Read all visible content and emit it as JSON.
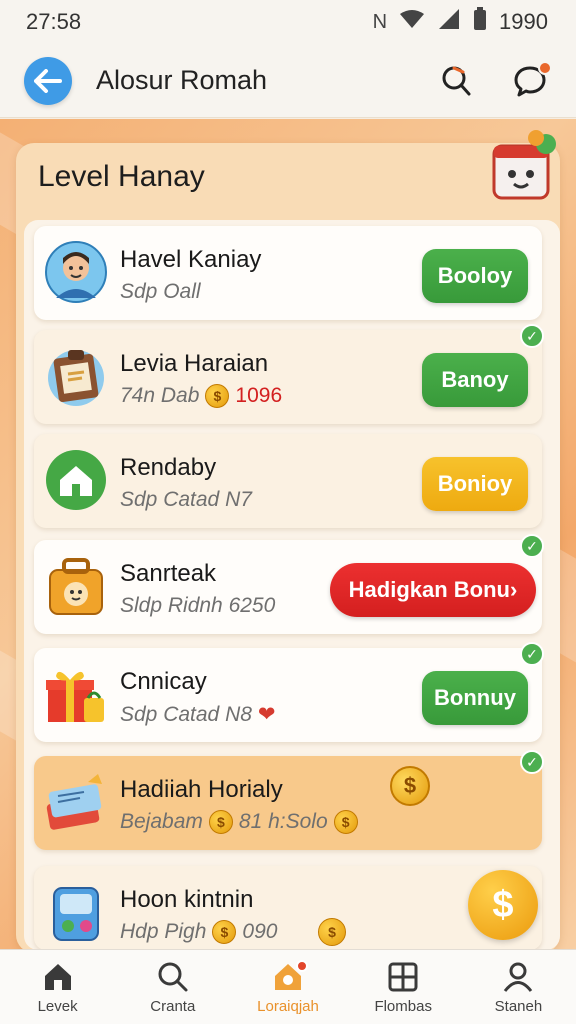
{
  "status_bar": {
    "time": "27:58",
    "battery": "1990"
  },
  "header": {
    "title": "Alosur Romah"
  },
  "panel": {
    "title": "Level Hanay"
  },
  "items": [
    {
      "title": "Havel Kaniay",
      "subtitle": "Sdp Oall",
      "button": "Booloy",
      "button_color": "#43a843",
      "checked": false,
      "icon": "avatar-icon"
    },
    {
      "title": "Levia Haraian",
      "subtitle": "74n Dab",
      "reward": "1096",
      "button": "Banoy",
      "button_color": "#43a843",
      "checked": true,
      "icon": "notebook-icon"
    },
    {
      "title": "Rendaby",
      "subtitle": "Sdp Catad N7",
      "button": "Bonioy",
      "button_color": "#f2b51c",
      "checked": false,
      "icon": "home-icon"
    },
    {
      "title": "Sanrteak",
      "subtitle": "Sldp Ridnh 6250",
      "button": "Hadigkan Bonu›",
      "button_color": "#e02828",
      "checked": true,
      "icon": "bag-icon"
    },
    {
      "title": "Cnnicay",
      "subtitle": "Sdp Catad N8",
      "button": "Bonnuy",
      "button_color": "#43a843",
      "checked": true,
      "icon": "gift-icon"
    },
    {
      "title": "Hadiiah Horialy",
      "subtitle": "Bejabam",
      "reward": "81 h:Solo",
      "checked": true,
      "icon": "book-icon"
    },
    {
      "title": "Hoon kintnin",
      "subtitle": "Hdp Pigh",
      "reward": "090",
      "icon": "robot-icon"
    }
  ],
  "tabs": [
    {
      "label": "Levek",
      "icon": "home-icon",
      "active": false
    },
    {
      "label": "Cranta",
      "icon": "search-icon",
      "active": false
    },
    {
      "label": "Loraiqjah",
      "icon": "gift-house-icon",
      "active": true
    },
    {
      "label": "Flombas",
      "icon": "grid-icon",
      "active": false
    },
    {
      "label": "Staneh",
      "icon": "profile-icon",
      "active": false
    }
  ]
}
